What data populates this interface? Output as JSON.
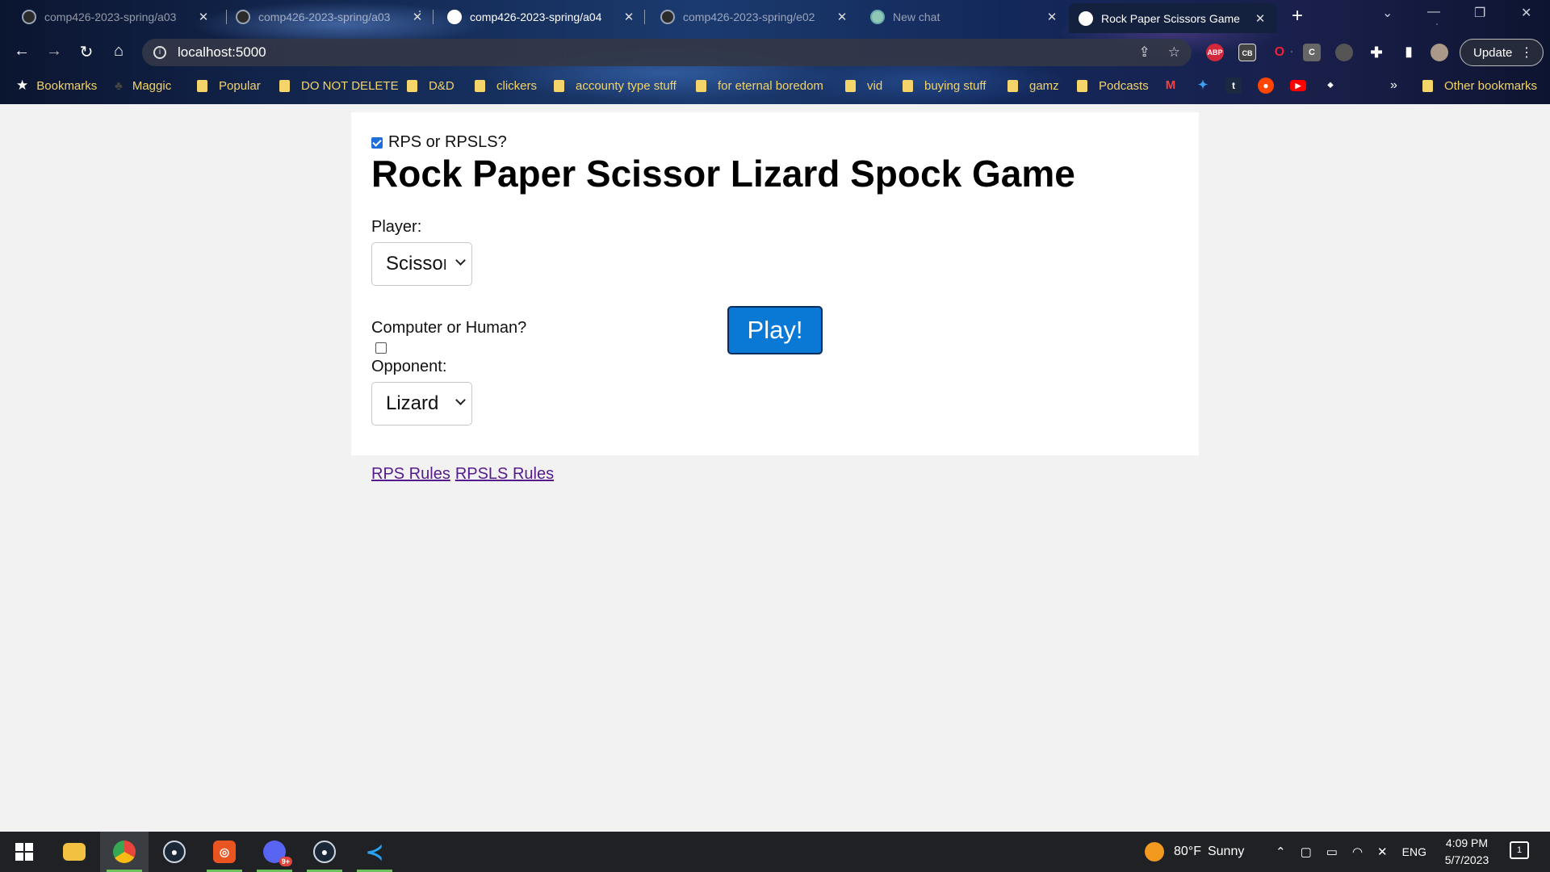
{
  "browser": {
    "tabs": [
      {
        "title": "comp426-2023-spring/a03",
        "active": false
      },
      {
        "title": "comp426-2023-spring/a03",
        "active": false
      },
      {
        "title": "comp426-2023-spring/a04",
        "active": false
      },
      {
        "title": "comp426-2023-spring/e02",
        "active": false
      },
      {
        "title": "New chat",
        "active": false
      },
      {
        "title": "Rock Paper Scissors Game",
        "active": true
      }
    ],
    "url": "localhost:5000",
    "update_label": "Update",
    "extensions": [
      "ABP",
      "CB",
      "O",
      "C"
    ],
    "bookmarks": {
      "bar_label": "Bookmarks",
      "items": [
        "Maggic",
        "Popular",
        "DO NOT DELETE",
        "D&D",
        "clickers",
        "accounty type stuff",
        "for eternal boredom",
        "vid",
        "buying stuff",
        "gamz",
        "Podcasts"
      ],
      "icons": [
        "gmail-icon",
        "twitter-icon",
        "tumblr-icon",
        "reddit-icon",
        "youtube-icon",
        "misc-icon"
      ],
      "overflow": "»",
      "other": "Other bookmarks"
    }
  },
  "page": {
    "mode_toggle": {
      "label": "RPS or RPSLS?",
      "checked": true
    },
    "title": "Rock Paper Scissor Lizard Spock Game",
    "player_label": "Player:",
    "player_value": "Scissor",
    "opponent_toggle": {
      "label": "Computer or Human?",
      "checked": false
    },
    "opponent_label": "Opponent:",
    "opponent_value": "Lizard",
    "play_label": "Play!",
    "links": {
      "rps": "RPS Rules",
      "rpsls": "RPSLS Rules"
    }
  },
  "taskbar": {
    "apps": [
      "windows-start-icon",
      "file-explorer-icon",
      "chrome-icon",
      "steam-icon",
      "ubuntu-icon",
      "discord-icon",
      "steam-icon",
      "vscode-icon"
    ],
    "discord_badge": "9+",
    "weather": {
      "temp": "80°F",
      "condition": "Sunny"
    },
    "language": "ENG",
    "time": "4:09 PM",
    "date": "5/7/2023",
    "notification_count": "1"
  },
  "colors": {
    "accent": "#0a79d6",
    "link_visited": "#551a8b",
    "bookmark_text": "#f3d46b",
    "page_bg": "#f2f2f2"
  }
}
